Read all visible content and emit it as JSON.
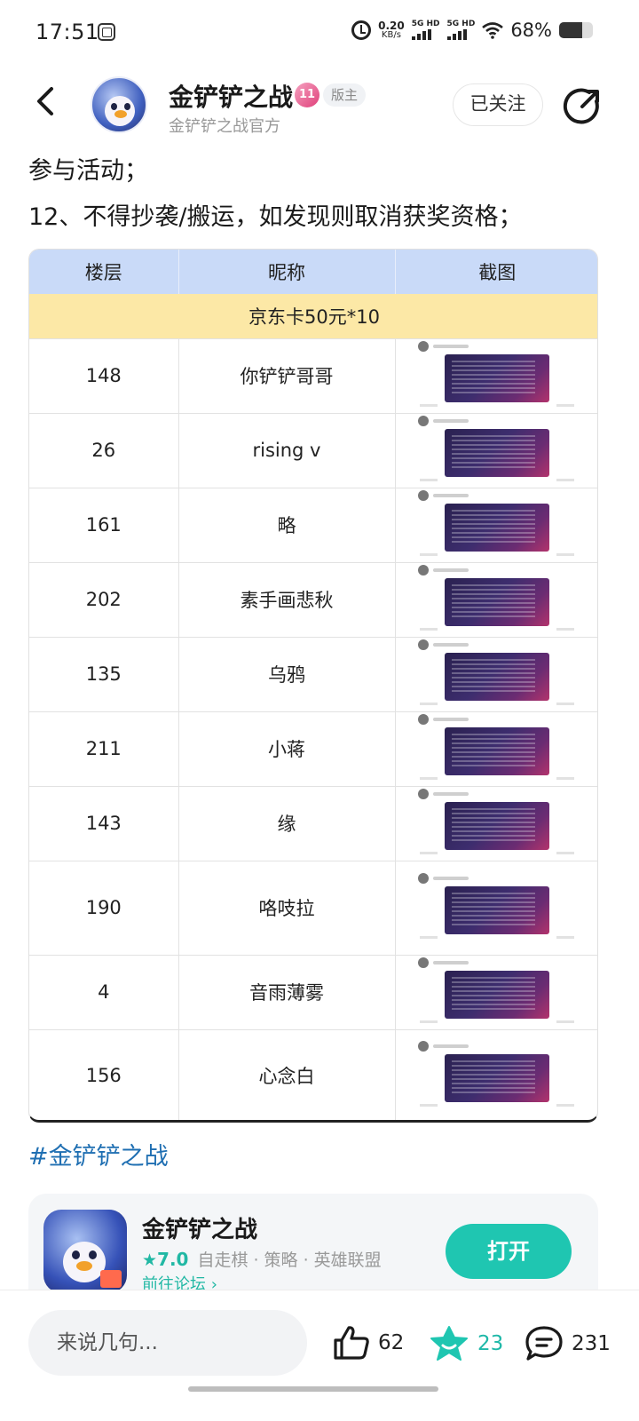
{
  "status_bar": {
    "time": "17:51",
    "net_speed_value": "0.20",
    "net_speed_unit": "KB/s",
    "sim1_label": "5G HD",
    "sim2_label": "5G HD",
    "battery": "68%",
    "battery_level": 0.68
  },
  "header": {
    "title": "金铲铲之战",
    "badge_level": "11",
    "role_tag": "版主",
    "subtitle": "金铲铲之战官方",
    "follow_label": "已关注"
  },
  "post": {
    "para1": "参与活动；",
    "para2": "12、不得抄袭/搬运，如发现则取消获奖资格；"
  },
  "table": {
    "headers": [
      "楼层",
      "昵称",
      "截图"
    ],
    "prize_row": "京东卡50元*10",
    "rows": [
      {
        "floor": "148",
        "nickname": "你铲铲哥哥"
      },
      {
        "floor": "26",
        "nickname": "rising v"
      },
      {
        "floor": "161",
        "nickname": "略"
      },
      {
        "floor": "202",
        "nickname": "素手画悲秋"
      },
      {
        "floor": "135",
        "nickname": "乌鸦"
      },
      {
        "floor": "211",
        "nickname": "小蒋"
      },
      {
        "floor": "143",
        "nickname": "缘"
      },
      {
        "floor": "190",
        "nickname": "咯吱拉"
      },
      {
        "floor": "4",
        "nickname": "音雨薄雾"
      },
      {
        "floor": "156",
        "nickname": "心念白"
      }
    ]
  },
  "hashtag": "#金铲铲之战",
  "app_card": {
    "name": "金铲铲之战",
    "star_icon": "★",
    "rating": "7.0",
    "tags": [
      "自走棋",
      "策略",
      "英雄联盟"
    ],
    "tag_separator": "·",
    "forum_link": "前往论坛 ›",
    "open_label": "打开"
  },
  "bottom_bar": {
    "input_placeholder": "来说几句...",
    "like_count": "62",
    "favorite_count": "23",
    "comment_count": "231"
  },
  "colors": {
    "accent_teal": "#1fc6b1",
    "table_header": "#c9daf8",
    "prize_row": "#fce8a6",
    "hashtag": "#1f6fb2"
  }
}
